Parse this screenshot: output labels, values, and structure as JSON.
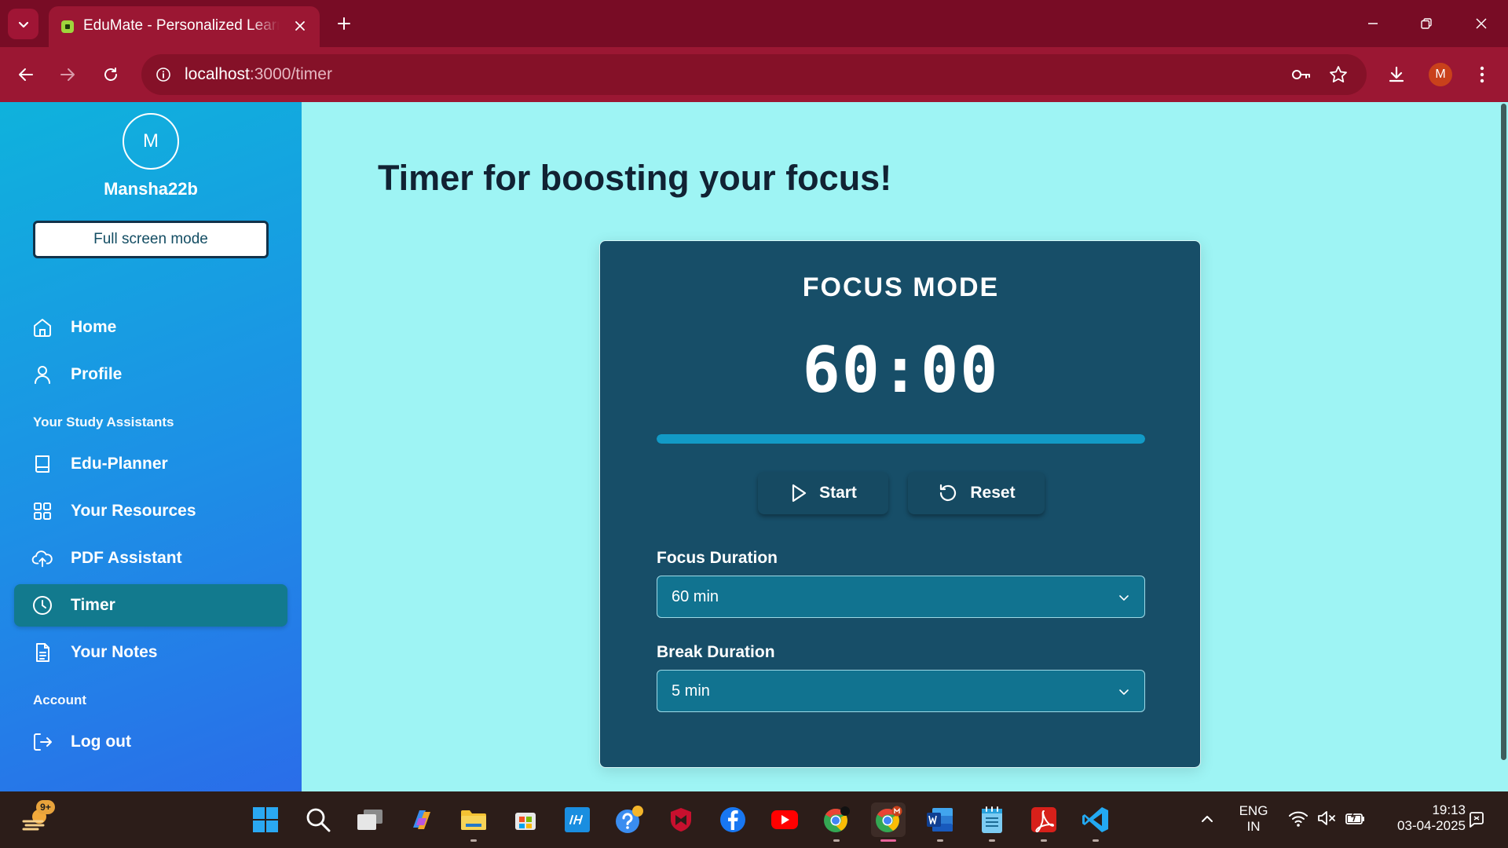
{
  "browser": {
    "tab_title": "EduMate - Personalized Learning",
    "url_host": "localhost",
    "url_path": ":3000/timer",
    "profile_initial": "M"
  },
  "sidebar": {
    "avatar_initial": "M",
    "username": "Mansha22b",
    "fullscreen_label": "Full screen mode",
    "nav_home": "Home",
    "nav_profile": "Profile",
    "section_study": "Your Study Assistants",
    "nav_planner": "Edu-Planner",
    "nav_resources": "Your Resources",
    "nav_pdf": "PDF Assistant",
    "nav_timer": "Timer",
    "nav_notes": "Your Notes",
    "section_account": "Account",
    "nav_logout": "Log out"
  },
  "main": {
    "page_title": "Timer for boosting your focus!",
    "mode_title": "FOCUS MODE",
    "time_display": "60:00",
    "progress_percent": 100,
    "start_label": "Start",
    "reset_label": "Reset",
    "focus_label": "Focus Duration",
    "focus_value": "60 min",
    "break_label": "Break Duration",
    "break_value": "5 min"
  },
  "taskbar": {
    "notification_badge": "9+",
    "lang_top": "ENG",
    "lang_bottom": "IN",
    "time": "19:13",
    "date": "03-04-2025"
  },
  "colors": {
    "browser_frame": "#780c25",
    "toolbar": "#9b1733",
    "page_bg": "#9ef4f4",
    "card_bg": "#174e68",
    "active_nav": "#127a8e",
    "progress_fill": "#129ac6"
  }
}
